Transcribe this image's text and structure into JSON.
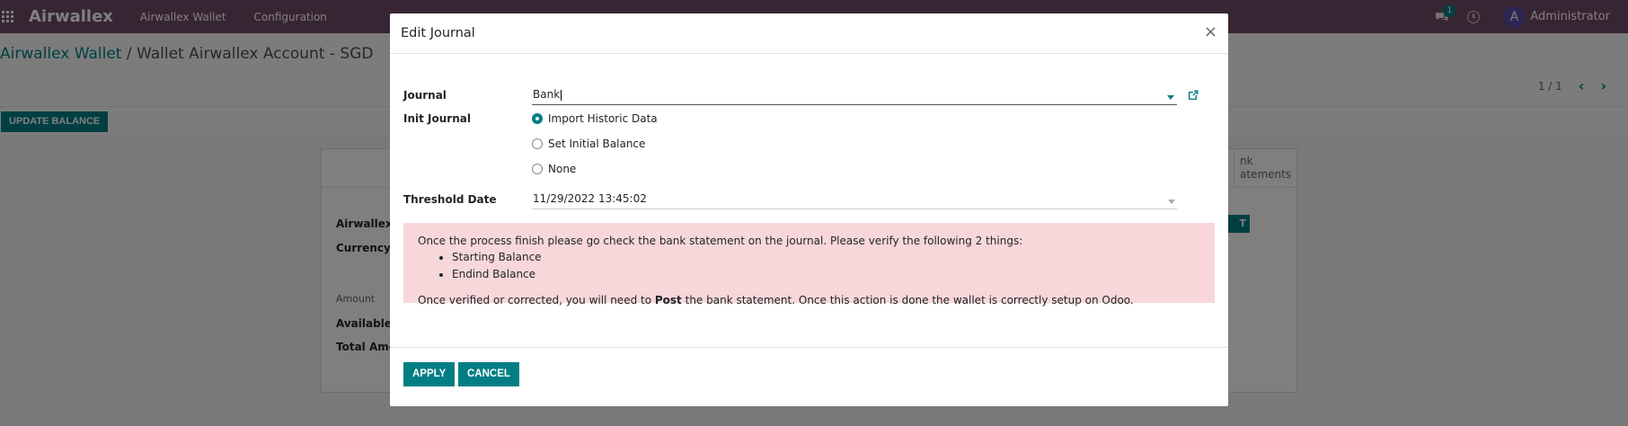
{
  "navbar": {
    "brand": "Airwallex",
    "menu": [
      "Airwallex Wallet",
      "Configuration"
    ],
    "chat_badge": "1",
    "user_initial": "A",
    "user_name": "Administrator"
  },
  "breadcrumb": {
    "parent": "Airwallex Wallet",
    "separator": " / ",
    "current": "Wallet Airwallex Account - SGD"
  },
  "pager": {
    "value": "1 / 1"
  },
  "actions": {
    "update_balance": "UPDATE BALANCE"
  },
  "background_form": {
    "smart_button": "nk\natements",
    "labels": {
      "airwallex_account": "Airwallex A",
      "currency": "Currency",
      "amount": "Amount",
      "available": "Available A",
      "total": "Total Amou"
    },
    "button_fragment": "T"
  },
  "modal": {
    "title": "Edit Journal",
    "close": "×",
    "fields": {
      "journal_label": "Journal",
      "journal_value": "Bank",
      "init_journal_label": "Init Journal",
      "init_options": [
        {
          "label": "Import Historic Data",
          "checked": true
        },
        {
          "label": "Set Initial Balance",
          "checked": false
        },
        {
          "label": "None",
          "checked": false
        }
      ],
      "threshold_label": "Threshold Date",
      "threshold_value": "11/29/2022 13:45:02"
    },
    "alert": {
      "line1": "Once the process finish please go check the bank statement on the journal. Please verify the following 2 things:",
      "items": [
        "Starting Balance",
        "Endind Balance"
      ],
      "line2_before": "Once verified or corrected, you will need to ",
      "line2_bold": "Post",
      "line2_after": " the bank statement. Once this action is done the wallet is correctly setup on Odoo."
    },
    "buttons": {
      "apply": "APPLY",
      "cancel": "CANCEL"
    }
  },
  "colors": {
    "navbar": "#714b67",
    "primary": "#017e84",
    "alert_bg": "#f8d7da"
  }
}
